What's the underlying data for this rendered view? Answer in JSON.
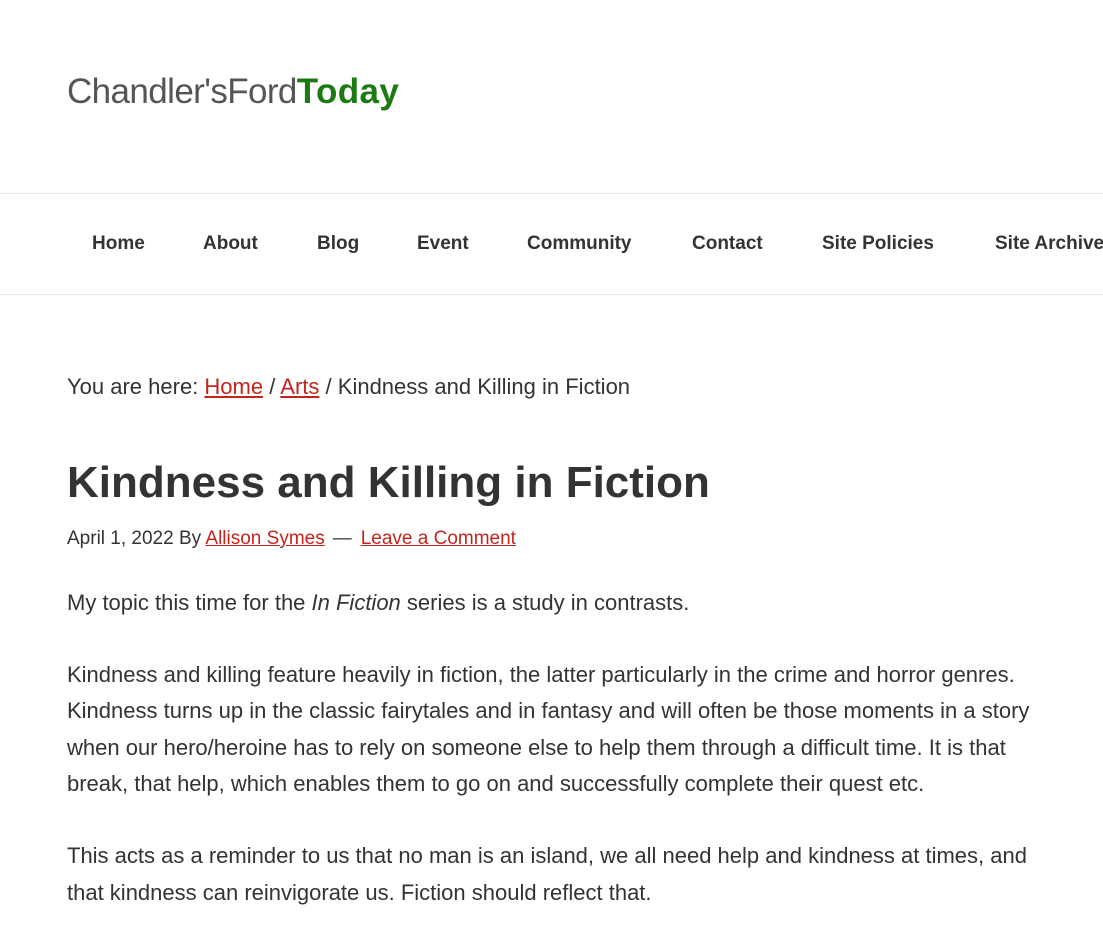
{
  "logo": {
    "part1": "Chandler's",
    "part2": "Ford",
    "part3": "Today"
  },
  "nav": {
    "items": [
      {
        "label": "Home"
      },
      {
        "label": "About"
      },
      {
        "label": "Blog"
      },
      {
        "label": "Event"
      },
      {
        "label": "Community"
      },
      {
        "label": "Contact"
      },
      {
        "label": "Site Policies"
      },
      {
        "label": "Site Archive"
      }
    ]
  },
  "breadcrumb": {
    "prefix": "You are here:",
    "home": "Home",
    "separator": "/",
    "category": "Arts",
    "current": "Kindness and Killing in Fiction"
  },
  "article": {
    "title": "Kindness and Killing in Fiction",
    "date": "April 1, 2022",
    "by": "By",
    "author": "Allison Symes",
    "dash": "—",
    "comment_link": "Leave a Comment",
    "p1_before": "My topic this time for the ",
    "p1_em": "In Fiction",
    "p1_after": " series is a study in contrasts.",
    "p2": "Kindness and killing feature heavily in fiction, the latter particularly in the crime and horror genres. Kindness turns up in the classic fairytales and in fantasy and will often be those moments in a story when our hero/heroine has to rely on someone else to help them through a difficult time. It is that break, that help, which enables them to go on and successfully complete their quest etc.",
    "p3": "This acts as a reminder to us that no man is an island, we all need help and kindness at times, and that kindness can reinvigorate us. Fiction should reflect that."
  },
  "colors": {
    "link": "#c3251d",
    "text": "#333333",
    "logo_accent": "#1d7a12",
    "border": "#e6e6e6"
  }
}
